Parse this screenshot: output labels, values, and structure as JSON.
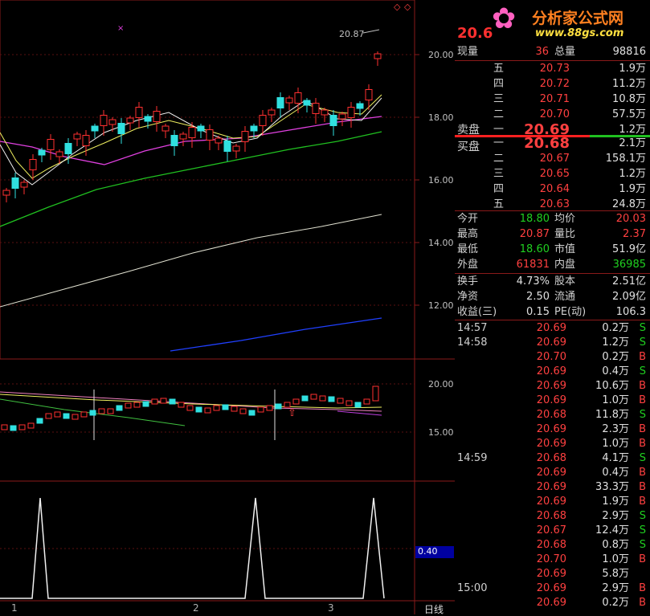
{
  "logo": {
    "title": "分析家公式网",
    "url": "www.88gs.com"
  },
  "chart": {
    "peak_label": "20.87",
    "main_axis": [
      "20.00",
      "18.00",
      "16.00",
      "14.00",
      "12.00"
    ],
    "sub_axis": [
      "20.00",
      "15.00"
    ],
    "indicator_value": "0.40",
    "date_ticks": [
      "1",
      "2",
      "3"
    ],
    "period_label": "日线"
  },
  "quote": {
    "price_partial": "20.6",
    "now_vol_label": "现量",
    "now_vol": "36",
    "total_vol_label": "总量",
    "total_vol": "98816",
    "sell_label": "卖盘",
    "buy_label": "买盘",
    "asks": [
      {
        "level": "五",
        "price": "20.73",
        "vol": "1.9万"
      },
      {
        "level": "四",
        "price": "20.72",
        "vol": "11.2万"
      },
      {
        "level": "三",
        "price": "20.71",
        "vol": "10.8万"
      },
      {
        "level": "二",
        "price": "20.70",
        "vol": "57.5万"
      },
      {
        "level": "一",
        "price": "20.69",
        "vol": "1.2万"
      }
    ],
    "bids": [
      {
        "level": "一",
        "price": "20.68",
        "vol": "2.1万"
      },
      {
        "level": "二",
        "price": "20.67",
        "vol": "158.1万"
      },
      {
        "level": "三",
        "price": "20.65",
        "vol": "1.2万"
      },
      {
        "level": "四",
        "price": "20.64",
        "vol": "1.9万"
      },
      {
        "level": "五",
        "price": "20.63",
        "vol": "24.8万"
      }
    ],
    "stats": [
      [
        "今开",
        "18.80",
        "grn",
        "均价",
        "20.03",
        "red"
      ],
      [
        "最高",
        "20.87",
        "red",
        "量比",
        "2.37",
        "red"
      ],
      [
        "最低",
        "18.60",
        "grn",
        "市值",
        "51.9亿",
        "wht"
      ],
      [
        "外盘",
        "61831",
        "red",
        "内盘",
        "36985",
        "grn"
      ]
    ],
    "fundamentals": [
      [
        "换手",
        "4.73%",
        "股本",
        "2.51亿"
      ],
      [
        "净资",
        "2.50",
        "流通",
        "2.09亿"
      ],
      [
        "收益(三)",
        "0.15",
        "PE(动)",
        "106.3"
      ]
    ]
  },
  "ticks": [
    {
      "time": "14:57",
      "price": "20.69",
      "vol": "0.2万",
      "side": "S"
    },
    {
      "time": "14:58",
      "price": "20.69",
      "vol": "1.2万",
      "side": "S"
    },
    {
      "time": "",
      "price": "20.70",
      "vol": "0.2万",
      "side": "B"
    },
    {
      "time": "",
      "price": "20.69",
      "vol": "0.4万",
      "side": "S"
    },
    {
      "time": "",
      "price": "20.69",
      "vol": "10.6万",
      "side": "B"
    },
    {
      "time": "",
      "price": "20.69",
      "vol": "1.0万",
      "side": "B"
    },
    {
      "time": "",
      "price": "20.68",
      "vol": "11.8万",
      "side": "S"
    },
    {
      "time": "",
      "price": "20.69",
      "vol": "2.3万",
      "side": "B"
    },
    {
      "time": "",
      "price": "20.69",
      "vol": "1.0万",
      "side": "B"
    },
    {
      "time": "14:59",
      "price": "20.68",
      "vol": "4.1万",
      "side": "S"
    },
    {
      "time": "",
      "price": "20.69",
      "vol": "0.4万",
      "side": "B"
    },
    {
      "time": "",
      "price": "20.69",
      "vol": "33.3万",
      "side": "B"
    },
    {
      "time": "",
      "price": "20.69",
      "vol": "1.9万",
      "side": "B"
    },
    {
      "time": "",
      "price": "20.68",
      "vol": "2.9万",
      "side": "S"
    },
    {
      "time": "",
      "price": "20.67",
      "vol": "12.4万",
      "side": "S"
    },
    {
      "time": "",
      "price": "20.68",
      "vol": "0.8万",
      "side": "S"
    },
    {
      "time": "",
      "price": "20.70",
      "vol": "1.0万",
      "side": "B"
    },
    {
      "time": "",
      "price": "20.69",
      "vol": "5.8万",
      "side": ""
    },
    {
      "time": "15:00",
      "price": "20.69",
      "vol": "2.9万",
      "side": "B"
    },
    {
      "time": "",
      "price": "20.69",
      "vol": "0.2万",
      "side": "B"
    }
  ]
}
